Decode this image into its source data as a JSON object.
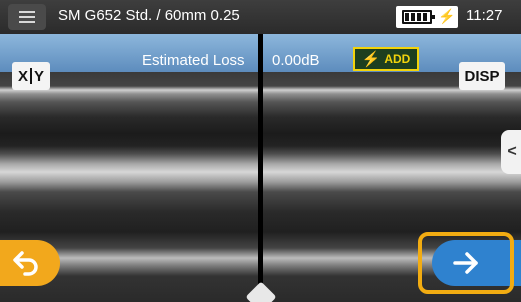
{
  "status_bar": {
    "fiber_mode": "SM G652 Std. / 60mm 0.25",
    "battery_cells": 4,
    "charging": true,
    "time": "11:27"
  },
  "info_band": {
    "loss_label": "Estimated Loss",
    "loss_value": "0.00dB",
    "add_label": "ADD"
  },
  "buttons": {
    "xy_x": "X",
    "xy_y": "Y",
    "disp": "DISP",
    "side_tab_glyph": "<"
  },
  "icons": {
    "menu": "hamburger-menu-icon",
    "battery": "battery-icon",
    "charge": "charging-bolt-icon",
    "add": "lightning-bolt-icon",
    "back": "return-arrow-icon",
    "next": "right-arrow-icon"
  },
  "colors": {
    "accent_orange": "#f2a81c",
    "next_blue": "#2f82cf",
    "band_blue": "#6f9ccb",
    "add_yellow": "#f2d30c"
  }
}
